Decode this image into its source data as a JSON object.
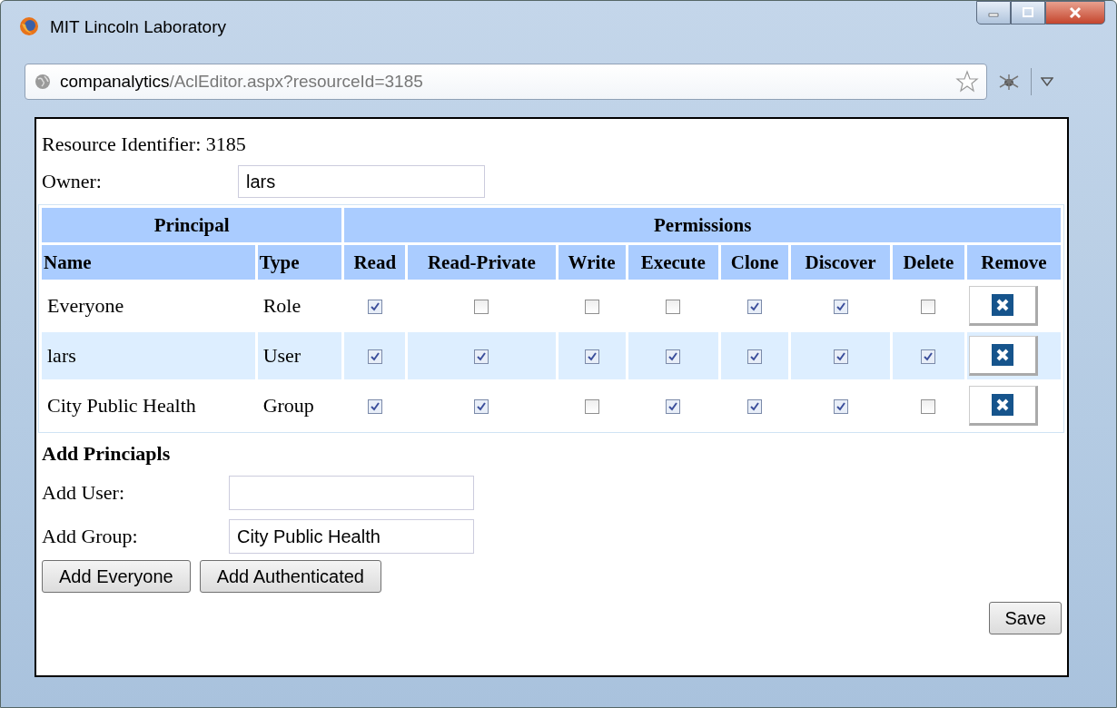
{
  "window": {
    "title": "MIT Lincoln Laboratory"
  },
  "address_bar": {
    "host": "companalytics",
    "path": "/AclEditor.aspx?resourceId=3185"
  },
  "resource": {
    "label": "Resource Identifier:",
    "value": "3185"
  },
  "owner": {
    "label": "Owner:",
    "value": "lars"
  },
  "table": {
    "group_headers": [
      "Principal",
      "Permissions"
    ],
    "columns": [
      "Name",
      "Type",
      "Read",
      "Read-Private",
      "Write",
      "Execute",
      "Clone",
      "Discover",
      "Delete",
      "Remove"
    ],
    "rows": [
      {
        "name": "Everyone",
        "type": "Role",
        "permissions": [
          {
            "checked": true
          },
          {
            "checked": false
          },
          {
            "checked": false
          },
          {
            "checked": false
          },
          {
            "checked": true
          },
          {
            "checked": true
          },
          {
            "checked": false
          }
        ]
      },
      {
        "name": "lars",
        "type": "User",
        "permissions": [
          {
            "checked": true
          },
          {
            "checked": true
          },
          {
            "checked": true
          },
          {
            "checked": true
          },
          {
            "checked": true
          },
          {
            "checked": true
          },
          {
            "checked": true
          }
        ]
      },
      {
        "name": "City Public Health",
        "type": "Group",
        "permissions": [
          {
            "checked": true
          },
          {
            "checked": true
          },
          {
            "checked": false
          },
          {
            "checked": true
          },
          {
            "checked": true
          },
          {
            "checked": true
          },
          {
            "checked": false
          }
        ]
      }
    ]
  },
  "add_principals": {
    "heading": "Add Princiapls",
    "user_label": "Add User:",
    "group_label": "Add Group:",
    "group_value": "City Public Health",
    "buttons": [
      "Add Everyone",
      "Add Authenticated"
    ]
  },
  "save_button": "Save"
}
